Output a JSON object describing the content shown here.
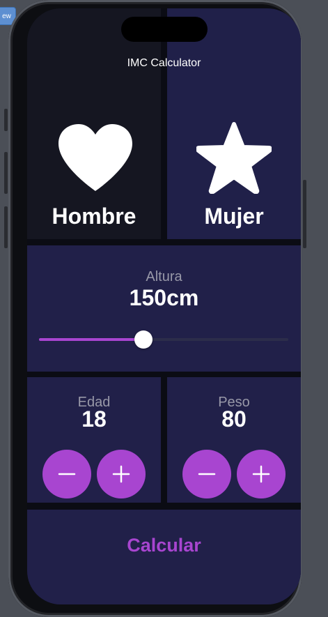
{
  "window": {
    "preview_tab": "ew"
  },
  "app": {
    "title": "IMC Calculator"
  },
  "gender": {
    "male_label": "Hombre",
    "female_label": "Mujer",
    "male_icon": "heart-icon",
    "female_icon": "star-icon"
  },
  "height": {
    "label": "Altura",
    "value_text": "150cm",
    "slider_fraction": 0.42
  },
  "age": {
    "label": "Edad",
    "value": "18",
    "decrement_icon": "minus-icon",
    "increment_icon": "plus-icon"
  },
  "weight": {
    "label": "Peso",
    "value": "80",
    "decrement_icon": "minus-icon",
    "increment_icon": "plus-icon"
  },
  "actions": {
    "calculate_label": "Calcular"
  },
  "colors": {
    "accent": "#a845d0",
    "card": "#212049",
    "card_selected": "#151621",
    "muted_text": "#9898a8"
  }
}
